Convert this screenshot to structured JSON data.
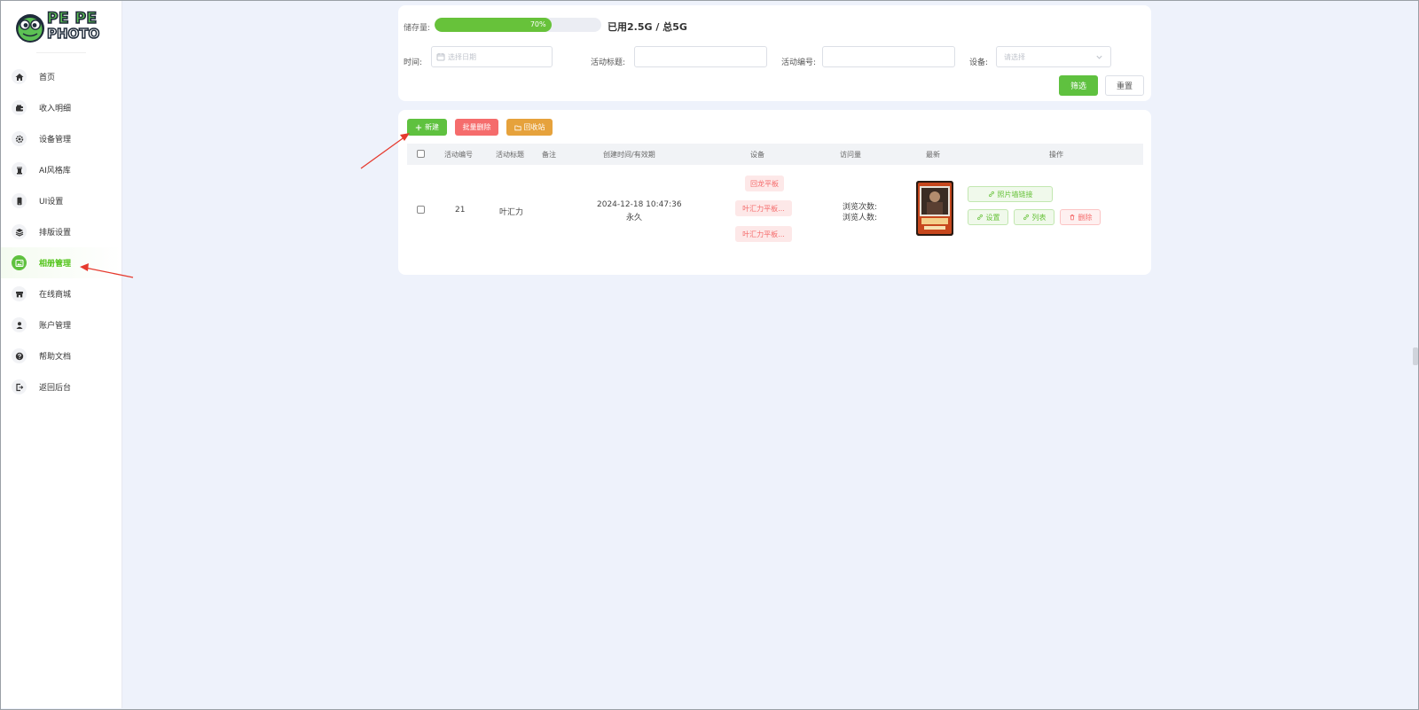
{
  "brand": {
    "logo_line1": "PE PE",
    "logo_line2": "PHOTO"
  },
  "sidebar": {
    "items": [
      {
        "label": "首页",
        "icon": "home-icon"
      },
      {
        "label": "收入明细",
        "icon": "wallet-icon"
      },
      {
        "label": "设备管理",
        "icon": "gear-icon"
      },
      {
        "label": "AI风格库",
        "icon": "chess-icon"
      },
      {
        "label": "UI设置",
        "icon": "phone-icon"
      },
      {
        "label": "排版设置",
        "icon": "layers-icon"
      },
      {
        "label": "相册管理",
        "icon": "image-icon",
        "active": true
      },
      {
        "label": "在线商城",
        "icon": "store-icon"
      },
      {
        "label": "账户管理",
        "icon": "user-icon"
      },
      {
        "label": "帮助文档",
        "icon": "help-icon"
      },
      {
        "label": "返回后台",
        "icon": "exit-icon"
      }
    ]
  },
  "storage": {
    "label": "储存量:",
    "percent": 70,
    "percent_text": "70%",
    "used_text": "已用2.5G / 总5G"
  },
  "filters": {
    "time_label": "时间:",
    "date_placeholder": "选择日期",
    "title_label": "活动标题:",
    "title_value": "",
    "id_label": "活动编号:",
    "id_value": "",
    "device_label": "设备:",
    "device_placeholder": "请选择",
    "filter_button": "筛选",
    "reset_button": "重置"
  },
  "toolbar": {
    "new_button": "新建",
    "bulk_delete_button": "批量删除",
    "recycle_button": "回收站"
  },
  "table": {
    "headers": [
      "活动编号",
      "活动标题",
      "备注",
      "创建时间/有效期",
      "设备",
      "访问量",
      "最新",
      "操作"
    ],
    "rows": [
      {
        "id": "21",
        "title": "叶汇力",
        "note": "",
        "created": "2024-12-18 10:47:36",
        "validity": "永久",
        "devices": [
          "回龙平板",
          "叶汇力平板...",
          "叶汇力平板..."
        ],
        "views_label": "浏览次数:",
        "visitors_label": "浏览人数:",
        "actions": {
          "wall_link": "照片墙链接",
          "settings": "设置",
          "list": "列表",
          "delete": "删除"
        }
      }
    ]
  },
  "colors": {
    "primary": "#5fc13f",
    "danger": "#f56c6c",
    "warning": "#e6a23c",
    "page_bg": "#eef2fb",
    "annotation": "#e63a2e"
  }
}
